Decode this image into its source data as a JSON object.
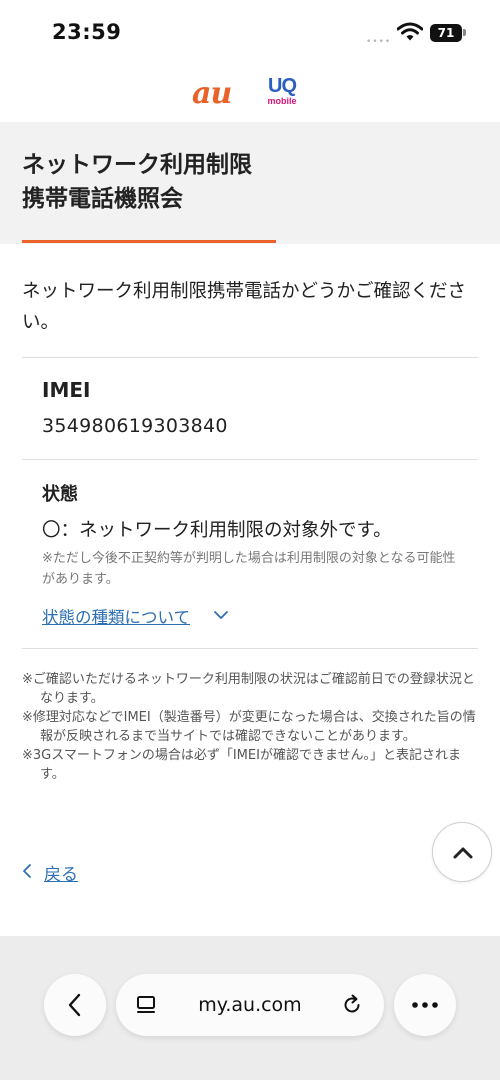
{
  "status_bar": {
    "time": "23:59",
    "signal_dots": "••••",
    "battery": "71"
  },
  "header": {
    "logo_au": "au",
    "logo_uq": "UQ",
    "logo_uq_sub": "mobile",
    "title_line1": "ネットワーク利用制限",
    "title_line2": "携帯電話機照会",
    "accent_color": "#e8622a"
  },
  "intro": "ネットワーク利用制限携帯電話かどうかご確認ください。",
  "imei": {
    "label": "IMEI",
    "value": "354980619303840"
  },
  "state": {
    "heading": "状態",
    "status": "〇：ネットワーク利用制限の対象外です。",
    "note": "※ただし今後不正契約等が判明した場合は利用制限の対象となる可能性があります。",
    "link": "状態の種類について"
  },
  "notes": [
    "※ご確認いただけるネットワーク利用制限の状況はご確認前日での登録状況となります。",
    "※修理対応などでIMEI（製造番号）が変更になった場合は、交換された旨の情報が反映されるまで当サイトでは確認できないことがあります。",
    "※3Gスマートフォンの場合は必ず「IMEIが確認できません。」と表記されます。"
  ],
  "back_link": "戻る",
  "browser": {
    "url": "my.au.com"
  },
  "icons": {
    "wifi": "wifi-icon",
    "scroll_top": "chevron-up-icon",
    "back": "chevron-left-icon",
    "tabs": "tabs-icon",
    "reload": "reload-icon",
    "more": "more-icon",
    "link_chevron": "chevron-down-icon"
  },
  "colors": {
    "link": "#2d6fb4",
    "logo_uq": "#2a5fc0",
    "logo_uq_sub": "#d2147a"
  }
}
